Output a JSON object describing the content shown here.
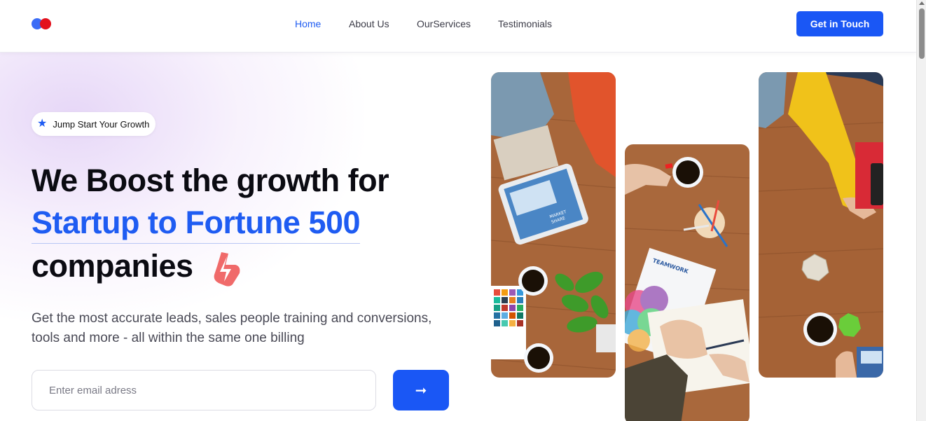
{
  "header": {
    "nav": [
      {
        "label": "Home",
        "active": true
      },
      {
        "label": "About Us",
        "active": false
      },
      {
        "label": "OurServices",
        "active": false
      },
      {
        "label": "Testimonials",
        "active": false
      }
    ],
    "cta_label": "Get in Touch"
  },
  "hero": {
    "badge": "Jump Start Your Growth",
    "headline_1": "We Boost the growth for",
    "headline_2": "Startup to Fortune 500",
    "headline_3": "companies",
    "subtitle": "Get the most accurate leads, sales people training and conversions, tools and more - all within the same one billing",
    "email_placeholder": "Enter email adress",
    "submit_icon": "arrow-right-icon"
  },
  "photos": {
    "tablet_caption_1": "MARKET",
    "tablet_caption_2": "SHARE",
    "booklet_title": "TEAMWORK"
  },
  "colors": {
    "accent": "#1a57f5",
    "brand_red": "#e3101c",
    "bolt": "#f06a6a"
  }
}
